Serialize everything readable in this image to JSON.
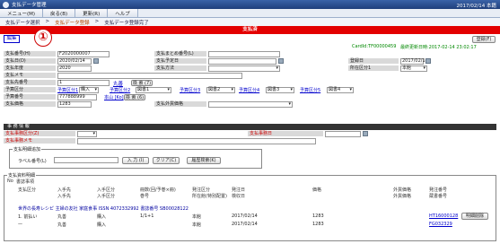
{
  "window": {
    "title": "支払データ管理",
    "date": "2017/02/14 本籍"
  },
  "menu": [
    "メニュー(M)",
    "戻る(B)",
    "更新(R)",
    "ヘルプ"
  ],
  "breadcrumb": [
    "支払データ選択",
    "支払データ登録",
    "支払データ登録完了"
  ],
  "banner": "支払済",
  "tab": "編集",
  "annotation": "①",
  "header_buttons": {
    "register": "登録(F)"
  },
  "header_info": {
    "card": "CardId:TF00000459",
    "updated": "最終更新日時:2017-02-14 23:02:17"
  },
  "fields": {
    "pay_no": {
      "label": "支払番号(H)",
      "value": "F2020000007"
    },
    "pay_date": {
      "label": "支払日(D)",
      "value": "2020/02/14"
    },
    "pay_year": {
      "label": "支払年度",
      "value": "2020"
    },
    "pay_memo": {
      "label": "支払メモ",
      "value": ""
    },
    "vendor_no": {
      "label": "支払先番号",
      "value": "1"
    },
    "vendor_link": "丸善",
    "search": "検 索 (7)",
    "pay_class": {
      "label": "予算区分",
      "value": ""
    },
    "budget1": {
      "label": "予算区分1",
      "value": "購入"
    },
    "budget2": {
      "label": "予算区分2",
      "value": "図書1"
    },
    "budget3": {
      "label": "予算区分3",
      "value": "図書2"
    },
    "budget4": {
      "label": "予算区分4",
      "value": "図書3"
    },
    "budget5": {
      "label": "予算区分5",
      "value": "図書4"
    },
    "budget_no": {
      "label": "予算番号",
      "value": "777888999"
    },
    "honbu": "本山 [Ko]",
    "search2": "検 索 (6)",
    "amount": {
      "label": "支払価格",
      "value": "1283"
    },
    "batch": {
      "label": "支払まとめ番号(L)",
      "value": ""
    },
    "due": {
      "label": "支払予定日",
      "value": ""
    },
    "method": {
      "label": "支払方法",
      "value": ""
    },
    "reg_date": {
      "label": "登録日",
      "value": "2017/02/14"
    },
    "place": {
      "label": "所在区分1",
      "value": "本館"
    },
    "foreign": {
      "label": "支払外貨価格",
      "value": ""
    }
  },
  "section_title": "事 務 情 報",
  "office": {
    "dept_label": "支払事務区分(Z)",
    "date_label": "支払事務日",
    "memo_label": "支払事務メモ"
  },
  "add_box": {
    "legend": "支払明細追加",
    "label": "ラベル番号(L)",
    "input_btn": "入 力 (I)",
    "clear_btn": "クリア(C)",
    "history_btn": "履歴検索(K)"
  },
  "list": {
    "legend": "支払資料明細",
    "heads1": [
      "No",
      "書誌事項"
    ],
    "heads2": [
      "支払区分",
      "入手先",
      "入手区分",
      "冊数(回/予巻×冊)",
      "発注区分",
      "発注日",
      "価格",
      "外貨価格",
      "発注番号"
    ],
    "heads3": [
      "",
      "入手先",
      "入手区分",
      "巻号",
      "所在館(特別配置)",
      "検収日",
      "",
      "外貨価格",
      "蔵書番号"
    ],
    "bib": "世界の長寿レシピ  主婦の友社  家庭食事 ISSN  4072332992 書誌番号 SB00028122",
    "rows": [
      [
        "1. 前払い",
        "丸善",
        "購入",
        "1/1+1",
        "本館",
        "2017/02/14",
        "1283",
        "",
        "HT16000128"
      ],
      [
        "—",
        "丸善",
        "購入",
        "",
        "本館",
        "2017/02/14",
        "1283",
        "",
        "FG032329"
      ]
    ],
    "row_btn": "明細削除"
  }
}
